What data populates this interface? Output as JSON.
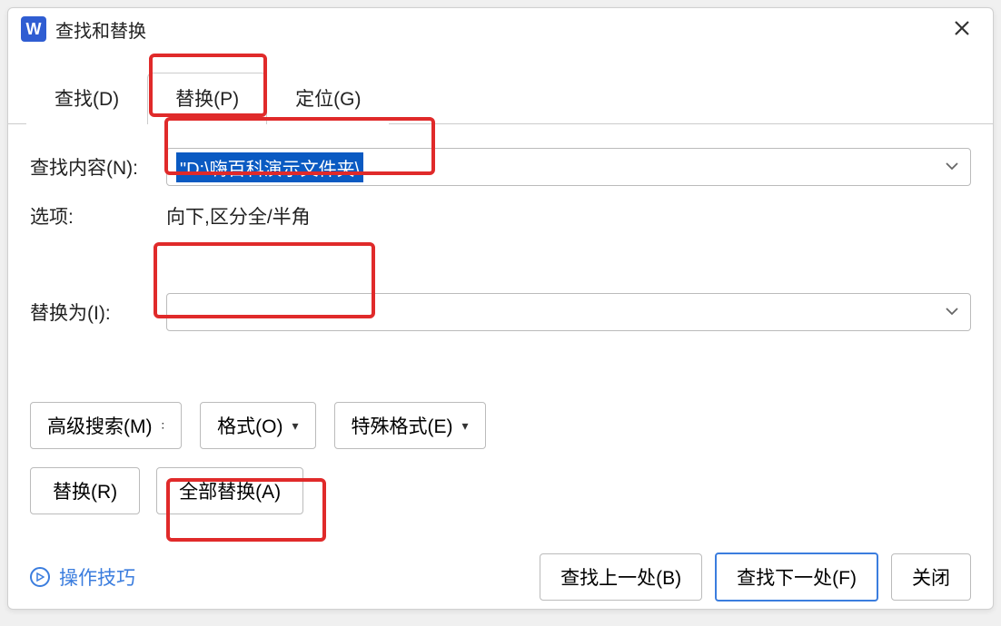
{
  "titlebar": {
    "app_icon_letter": "W",
    "title": "查找和替换"
  },
  "tabs": {
    "find": "查找(D)",
    "replace": "替换(P)",
    "goto": "定位(G)",
    "active": "replace"
  },
  "find": {
    "label": "查找内容(N):",
    "value": "\"D:\\嗨百科演示文件夹\\"
  },
  "options": {
    "label": "选项:",
    "value": "向下,区分全/半角"
  },
  "replace": {
    "label": "替换为(I):",
    "value": ""
  },
  "toolbar": {
    "advanced": "高级搜索(M)",
    "format": "格式(O)",
    "special": "特殊格式(E)"
  },
  "actions": {
    "replace_one": "替换(R)",
    "replace_all": "全部替换(A)"
  },
  "footer": {
    "tips": "操作技巧",
    "find_prev": "查找上一处(B)",
    "find_next": "查找下一处(F)",
    "close": "关闭"
  }
}
